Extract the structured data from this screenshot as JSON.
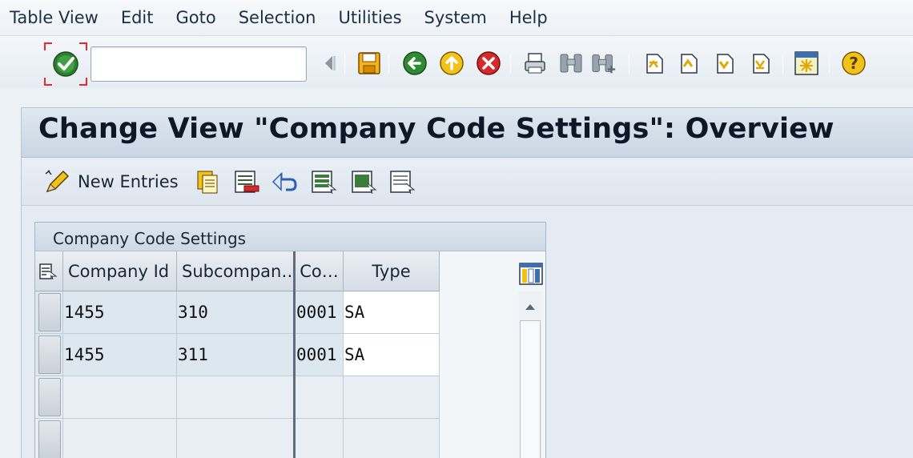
{
  "menu": [
    "Table View",
    "Edit",
    "Goto",
    "Selection",
    "Utilities",
    "System",
    "Help"
  ],
  "command_field": {
    "value": ""
  },
  "toolbar_icons": [
    "enter-icon",
    "command-expand-icon",
    "save-icon",
    "back-icon",
    "exit-icon",
    "cancel-icon",
    "print-icon",
    "find-icon",
    "find-next-icon",
    "first-page-icon",
    "previous-page-icon",
    "next-page-icon",
    "last-page-icon",
    "customize-layout-icon",
    "help-icon"
  ],
  "screen": {
    "title": "Change View \"Company Code Settings\": Overview"
  },
  "app_toolbar": {
    "new_entries": "New Entries"
  },
  "table": {
    "title": "Company Code Settings",
    "columns": [
      "Company Id",
      "Subcompan…",
      "Co…",
      "Type"
    ],
    "rows": [
      [
        "1455",
        "310",
        "0001",
        "SA"
      ],
      [
        "1455",
        "311",
        "0001",
        "SA"
      ],
      [
        "",
        "",
        "",
        ""
      ],
      [
        "",
        "",
        "",
        ""
      ]
    ]
  },
  "colors": {
    "accent_red": "#e8282a",
    "title_bg": "#c9d6e3",
    "panel_bg": "#e4ebf2"
  }
}
